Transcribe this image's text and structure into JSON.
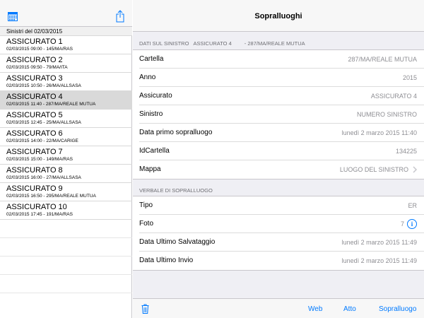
{
  "left": {
    "section_header": "Sinistri del 02/03/2015",
    "items": [
      {
        "title": "ASSICURATO 1",
        "sub": "02/03/2015 09:00 - 145/MA/RAS",
        "selected": false
      },
      {
        "title": "ASSICURATO 2",
        "sub": "02/03/2015 09:50 - 79/MA/ITA",
        "selected": false
      },
      {
        "title": "ASSICURATO 3",
        "sub": "02/03/2015 10:50 - 26/MA/ALLSASA",
        "selected": false
      },
      {
        "title": "ASSICURATO 4",
        "sub": "02/03/2015 11:40 - 287/MA/REALE MUTUA",
        "selected": true
      },
      {
        "title": "ASSICURATO 5",
        "sub": "02/03/2015 12:45 - 25/MA/ALLSASA",
        "selected": false
      },
      {
        "title": "ASSICURATO 6",
        "sub": "02/03/2015 14:00 - 22/MA/CARIGE",
        "selected": false
      },
      {
        "title": "ASSICURATO 7",
        "sub": "02/03/2015 15:00 - 149/MA/RAS",
        "selected": false
      },
      {
        "title": "ASSICURATO 8",
        "sub": "02/03/2015 16:00 - 27/MA/ALLSASA",
        "selected": false
      },
      {
        "title": "ASSICURATO 9",
        "sub": "02/03/2015 16:50 - 295/MA/REALE MUTUA",
        "selected": false
      },
      {
        "title": "ASSICURATO 10",
        "sub": "02/03/2015 17:45 - 191/MA/RAS",
        "selected": false
      }
    ],
    "icons": {
      "calendar": "calendar-icon",
      "share": "share-icon"
    }
  },
  "nav": {
    "title": "Sopralluoghi"
  },
  "group1": {
    "header": "DATI SUL SINISTRO",
    "header_extra": "ASSICURATO 4",
    "header_extra2": "- 287/MA/REALE MUTUA",
    "rows": [
      {
        "label": "Cartella",
        "value": "287/MA/REALE MUTUA"
      },
      {
        "label": "Anno",
        "value": "2015"
      },
      {
        "label": "Assicurato",
        "value": "ASSICURATO 4"
      },
      {
        "label": "Sinistro",
        "value": "NUMERO SINISTRO"
      },
      {
        "label": "Data primo sopralluogo",
        "value": "lunedì 2 marzo 2015 11:40"
      },
      {
        "label": "IdCartella",
        "value": "134225"
      },
      {
        "label": "Mappa",
        "value": "LUOGO DEL SINISTRO"
      }
    ]
  },
  "group2": {
    "header": "VERBALE DI SOPRALLUOGO",
    "rows": [
      {
        "label": "Tipo",
        "value": "ER"
      },
      {
        "label": "Foto",
        "value": "7"
      },
      {
        "label": "Data Ultimo Salvataggio",
        "value": "lunedì 2 marzo 2015 11:49"
      },
      {
        "label": "Data Ultimo Invio",
        "value": "lunedì 2 marzo 2015 11:49"
      }
    ]
  },
  "toolbar": {
    "web": "Web",
    "atto": "Atto",
    "sopralluogo": "Sopralluogo"
  },
  "colors": {
    "accent": "#007aff",
    "selected_row": "#d9d9d9",
    "group_bg": "#efeff4"
  }
}
